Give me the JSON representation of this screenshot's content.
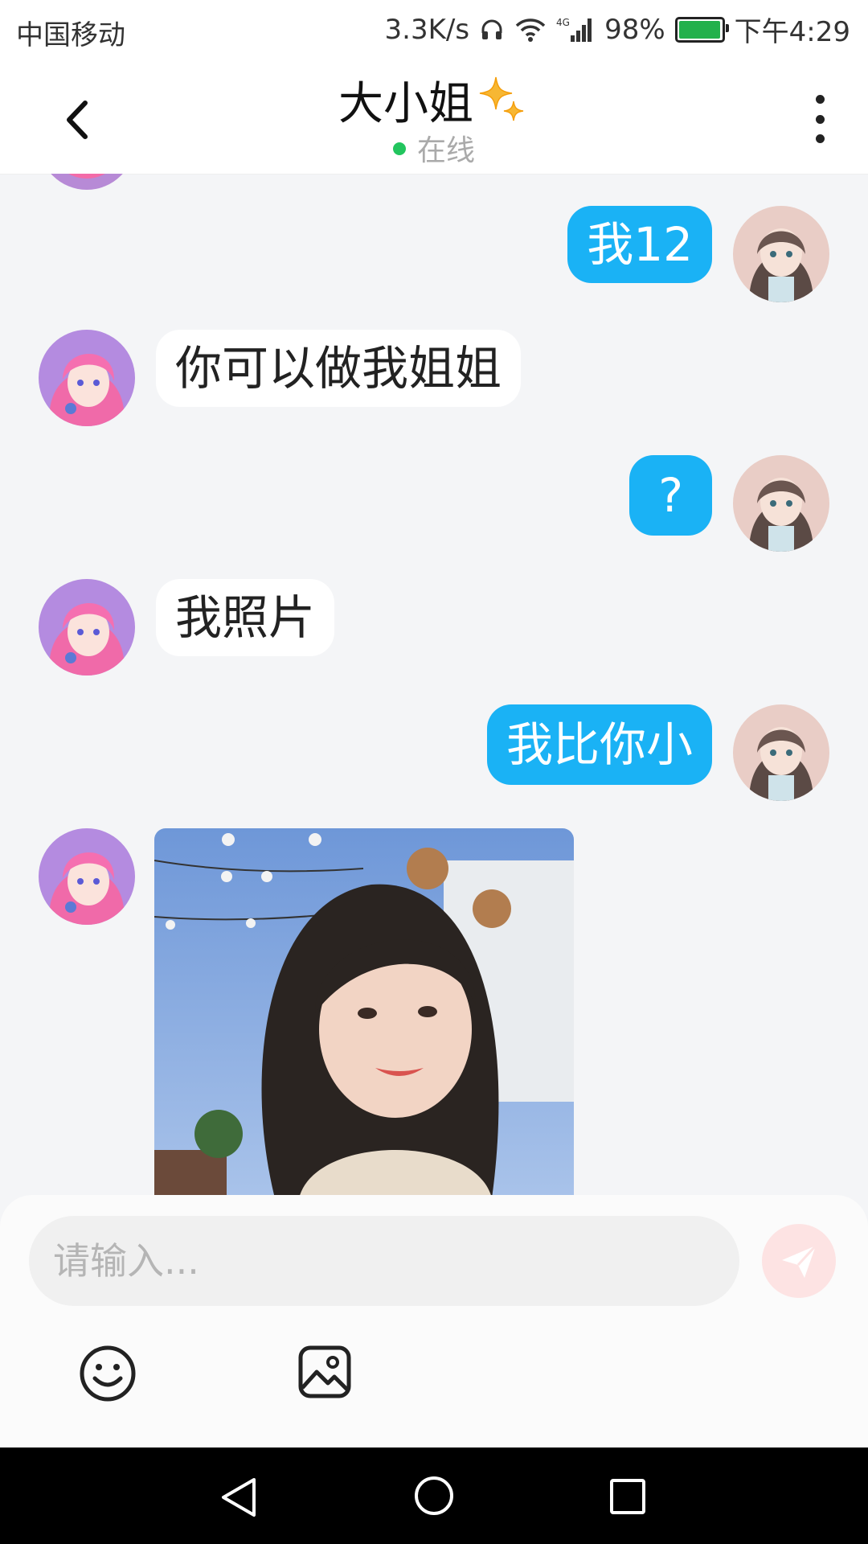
{
  "status_bar": {
    "carrier": "中国移动",
    "speed": "3.3K/s",
    "network": "4G",
    "battery": "98%",
    "battery_level": 0.98,
    "time": "下午4:29"
  },
  "header": {
    "title": "大小姐",
    "status": "在线"
  },
  "messages": [
    {
      "side": "out",
      "text": "我12"
    },
    {
      "side": "in",
      "text": "你可以做我姐姐"
    },
    {
      "side": "out",
      "text": "?"
    },
    {
      "side": "in",
      "text": "我照片"
    },
    {
      "side": "out",
      "text": "我比你小"
    },
    {
      "side": "in",
      "type": "image"
    }
  ],
  "composer": {
    "placeholder": "请输入..."
  },
  "icons": {
    "back": "chevron-left-icon",
    "more": "more-vertical-icon",
    "send": "send-icon",
    "emoji": "emoji-icon",
    "image": "image-icon",
    "sparkle": "sparkle-icon",
    "accent": "#1ab2f5"
  }
}
